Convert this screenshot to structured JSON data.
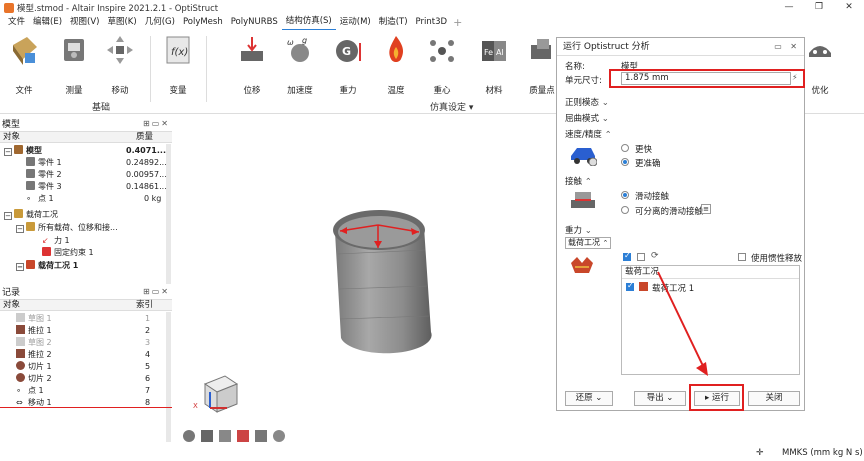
{
  "titlebar": {
    "title": "模型.stmod - Altair Inspire 2021.2.1 - OptiStruct"
  },
  "menu": [
    "文件",
    "编辑(E)",
    "视图(V)",
    "草图(K)",
    "几何(G)",
    "PolyMesh",
    "PolyNURBS",
    "结构仿真(S)",
    "运动(M)",
    "制造(T)",
    "Print3D"
  ],
  "ribbon": {
    "tools": [
      "文件",
      "测量",
      "移动",
      "变量",
      "位移",
      "加速度",
      "重力",
      "温度",
      "重心",
      "材料",
      "质量点",
      "优化"
    ],
    "group_basic": "基础",
    "group_sim": "仿真设定",
    "group_sim_arrow": "▾"
  },
  "model_panel": {
    "title": "模型",
    "col_object": "对象",
    "col_mass": "质量",
    "rows": [
      {
        "label": "模型",
        "value": "0.4071..."
      },
      {
        "label": "零件 1",
        "value": "0.24892..."
      },
      {
        "label": "零件 2",
        "value": "0.00957..."
      },
      {
        "label": "零件 3",
        "value": "0.14861..."
      },
      {
        "label": "点 1",
        "value": "0 kg"
      },
      {
        "label": "载荷工况",
        "value": ""
      },
      {
        "label": "所有载荷、位移和接...",
        "value": ""
      },
      {
        "label": "力 1",
        "value": ""
      },
      {
        "label": "固定约束 1",
        "value": ""
      },
      {
        "label": "载荷工况 1",
        "value": ""
      }
    ]
  },
  "history_panel": {
    "title": "记录",
    "col_object": "对象",
    "col_index": "索引",
    "rows": [
      {
        "label": "草图 1",
        "index": "1"
      },
      {
        "label": "推拉 1",
        "index": "2"
      },
      {
        "label": "草图 2",
        "index": "3"
      },
      {
        "label": "推拉 2",
        "index": "4"
      },
      {
        "label": "切片 1",
        "index": "5"
      },
      {
        "label": "切片 2",
        "index": "6"
      },
      {
        "label": "点 1",
        "index": "7"
      },
      {
        "label": "移动 1",
        "index": "8"
      }
    ]
  },
  "dialog": {
    "title": "运行 Optistruct 分析",
    "name_label": "名称:",
    "name_value": "模型",
    "element_size_label": "单元尺寸:",
    "element_size_value": "1.875 mm",
    "normal_modes": "正则模态",
    "buckling_modes": "屈曲模式",
    "speed_accuracy": "速度/精度",
    "faster": "更快",
    "more_accurate": "更准确",
    "contacts": "接触",
    "sliding_contact": "滑动接触",
    "separable_sliding": "可分离的滑动接触",
    "gravity": "重力",
    "load_case_dropdown": "载荷工况",
    "use_inertia_relief": "使用惯性释放",
    "list_header": "载荷工况",
    "list_item": "载荷工况 1",
    "restore": "还原",
    "export": "导出",
    "run": "运行",
    "close": "关闭"
  },
  "statusbar": {
    "units": "MMKS (mm kg N s)"
  },
  "colors": {
    "highlight": "#e02020",
    "accent": "#2c7fd6"
  }
}
